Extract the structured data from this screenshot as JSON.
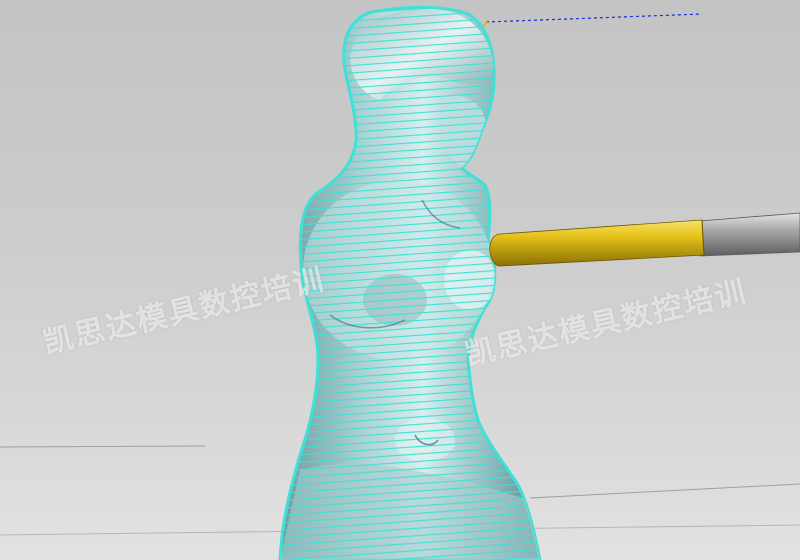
{
  "scene": {
    "model_name": "statue",
    "tool_name": "cutting-tool",
    "toolpath_color": "#3fe0d6",
    "model_color": "#8fb9bb",
    "tool_color": "#e6c21a",
    "holder_color": "#a8a8a8",
    "background_top": "#c4c4c4",
    "background_bottom": "#e2e2e2"
  },
  "watermarks": [
    {
      "text": "凯思达模具数控培训"
    },
    {
      "text": "凯思达模具数控培训"
    }
  ]
}
